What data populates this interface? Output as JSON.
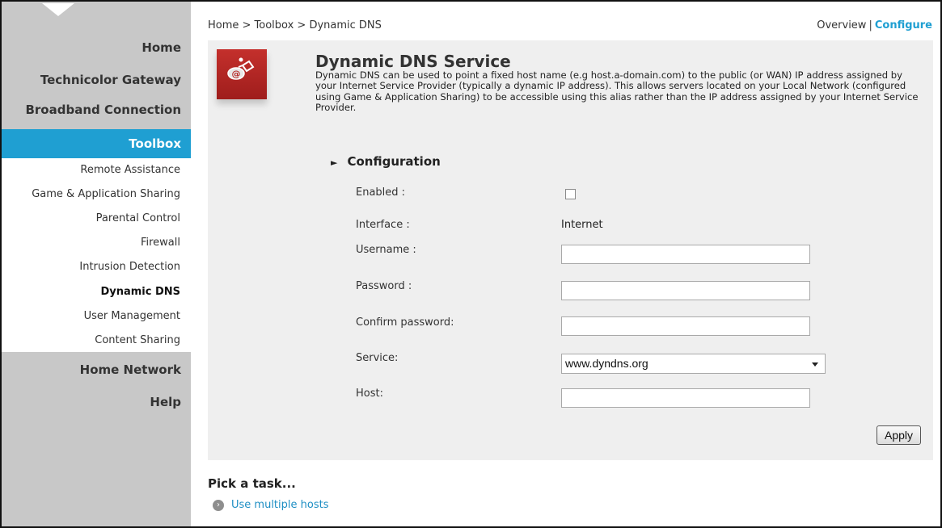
{
  "breadcrumb": "Home > Toolbox > Dynamic DNS",
  "topnav": {
    "overview": "Overview",
    "separator": "|",
    "configure": "Configure"
  },
  "sidebar": {
    "main": [
      "Home",
      "Technicolor Gateway",
      "Broadband Connection"
    ],
    "active": "Toolbox",
    "sub": [
      "Remote Assistance",
      "Game & Application Sharing",
      "Parental Control",
      "Firewall",
      "Intrusion Detection",
      "Dynamic DNS",
      "User Management",
      "Content Sharing"
    ],
    "current_sub": "Dynamic DNS",
    "bottom": [
      "Home Network",
      "Help"
    ]
  },
  "page": {
    "title": "Dynamic DNS Service",
    "description": "Dynamic DNS can be used to point a fixed host name (e.g host.a-domain.com) to the public (or WAN) IP address assigned by your Internet Service Provider (typically a dynamic IP address). This allows servers located on your Local Network (configured using Game & Application Sharing) to be accessible using this alias rather than the IP address assigned by your Internet Service Provider."
  },
  "config": {
    "heading": "Configuration",
    "enabled_label": "Enabled :",
    "enabled_checked": false,
    "interface_label": "Interface :",
    "interface_value": "Internet",
    "username_label": "Username :",
    "username_value": "",
    "password_label": "Password :",
    "password_value": "",
    "confirm_label": "Confirm password:",
    "confirm_value": "",
    "service_label": "Service:",
    "service_value": "www.dyndns.org",
    "host_label": "Host:",
    "host_value": "",
    "apply_label": "Apply"
  },
  "tasks": {
    "title": "Pick a task...",
    "items": [
      "Use multiple hosts"
    ]
  },
  "colors": {
    "accent": "#1f9fd2",
    "sidebar_bg": "#c8c8c8",
    "panel_bg": "#efefef",
    "icon_red": "#b52826"
  },
  "icons": {
    "module": "dyndns-module-icon",
    "task_bullet": "chevron-right-circle-icon",
    "section": "triangle-right-icon"
  }
}
